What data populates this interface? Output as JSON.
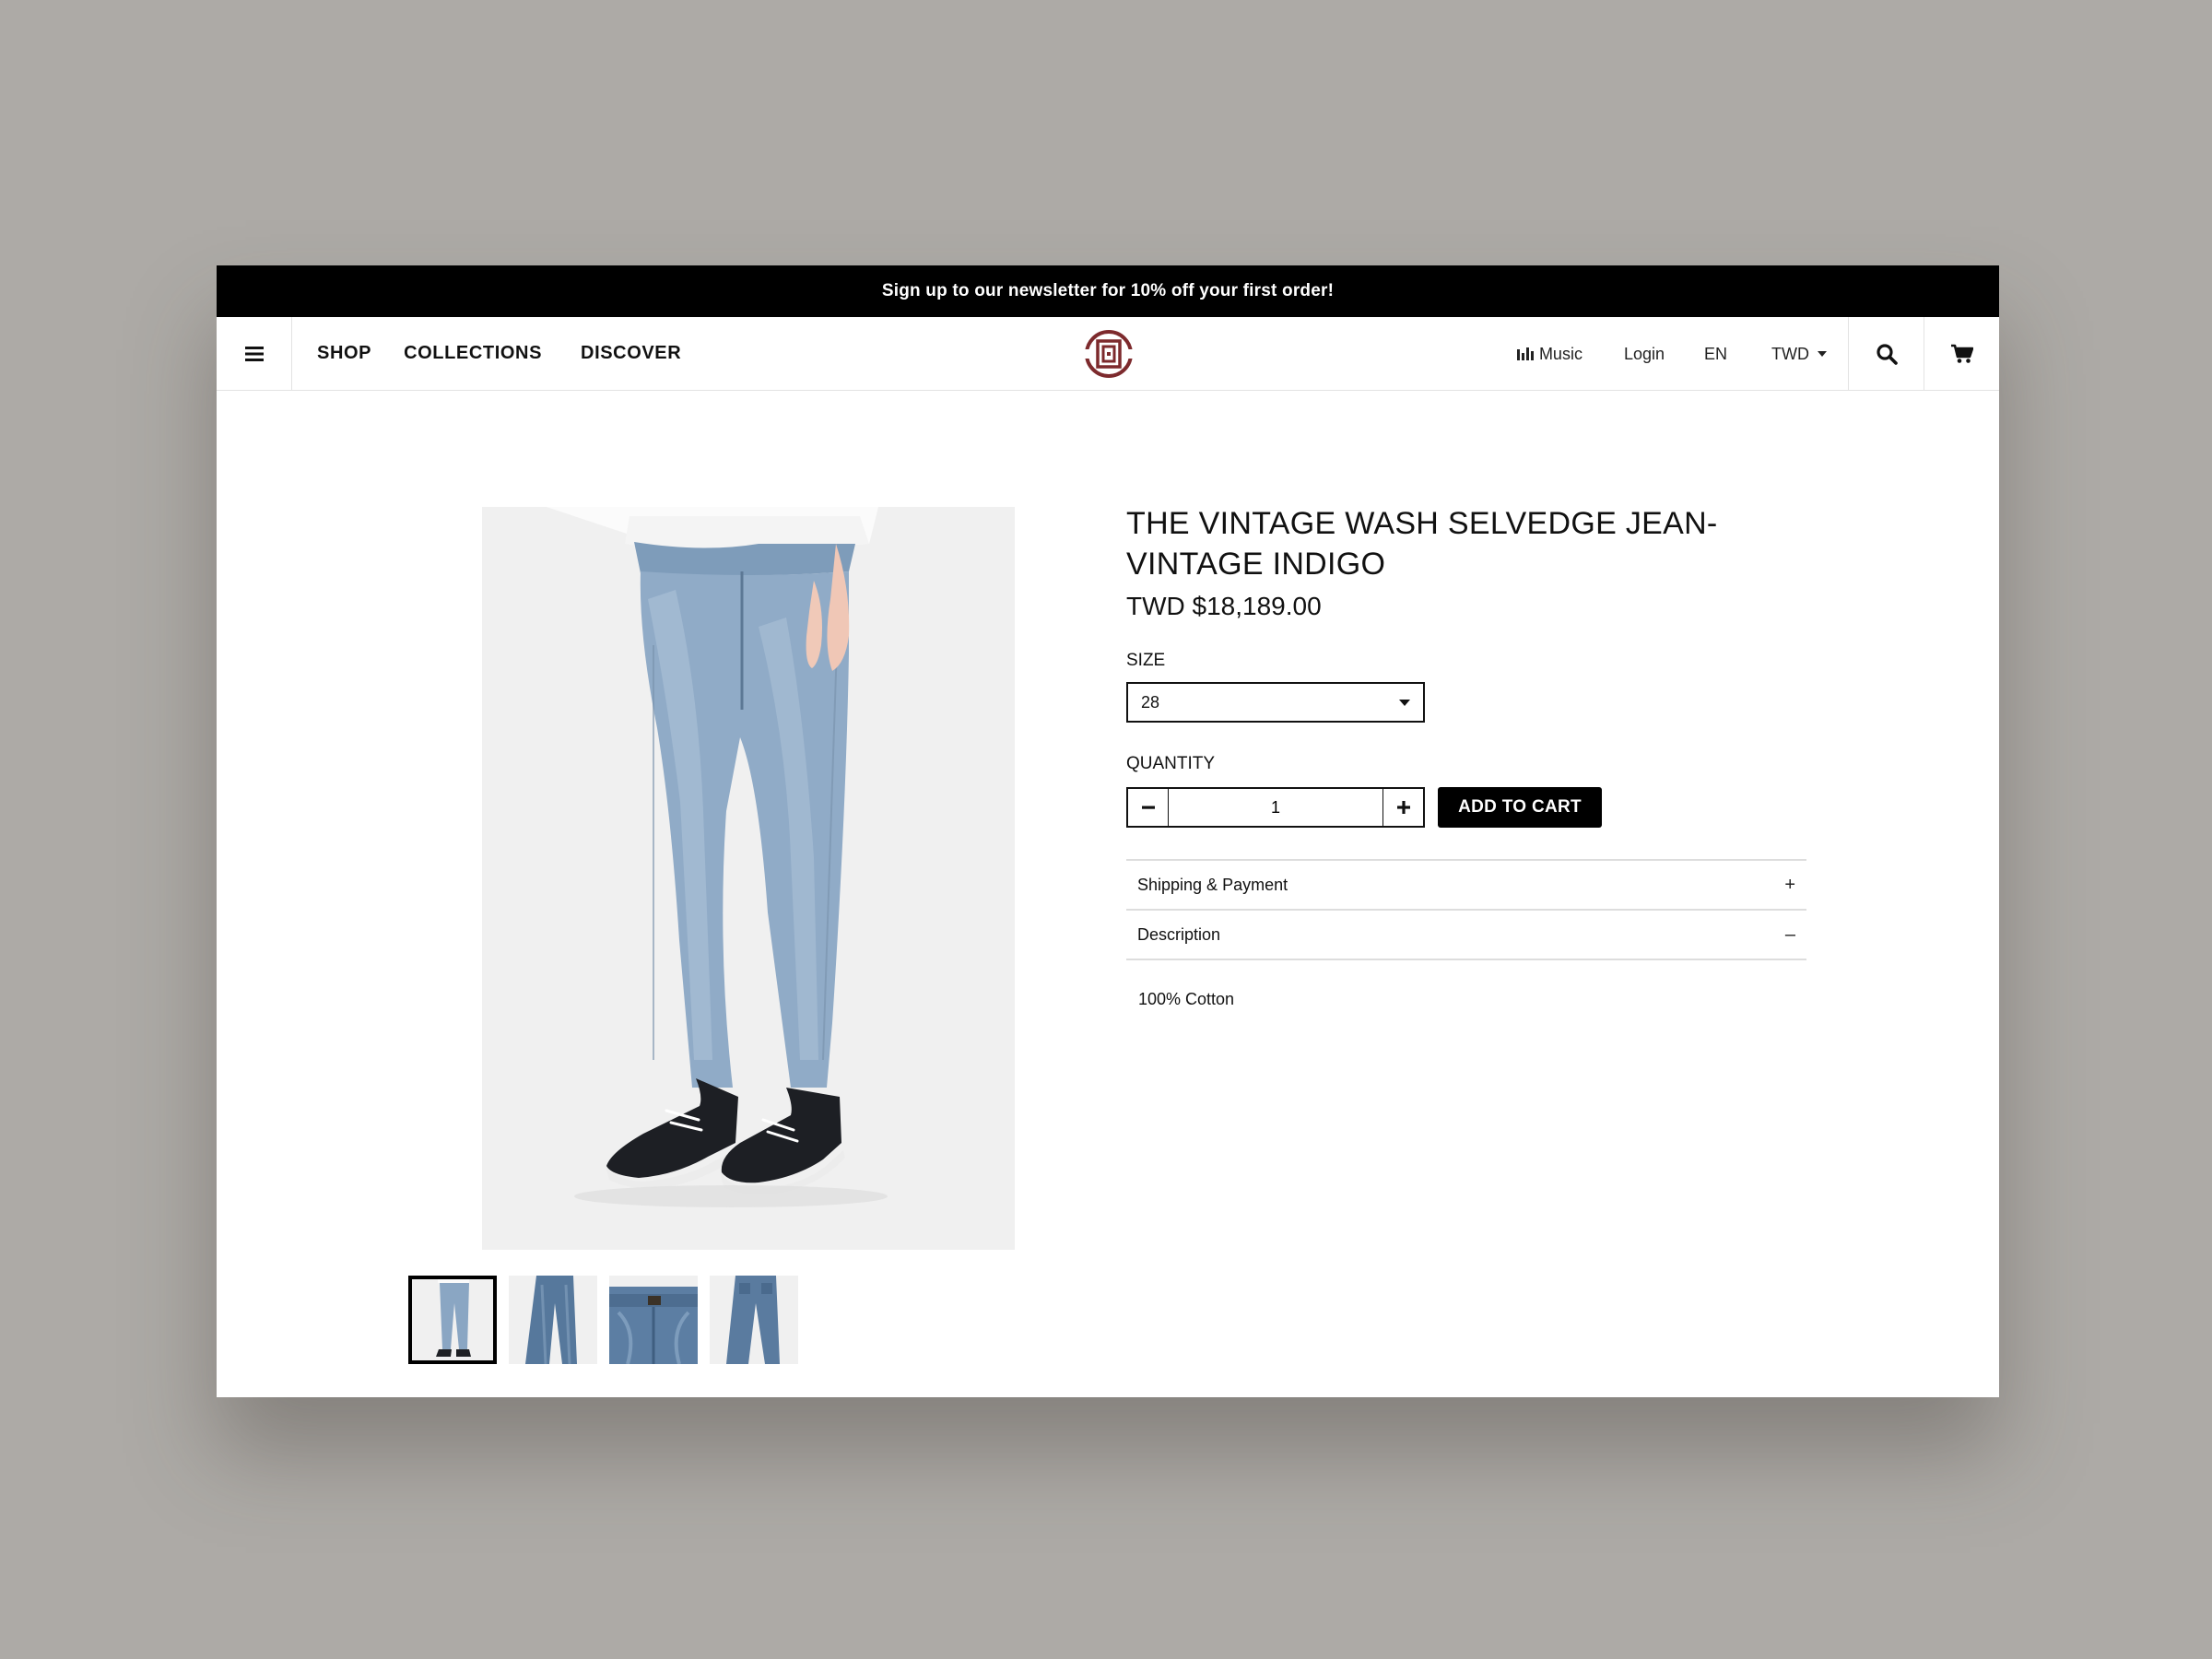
{
  "promo": {
    "text": "Sign up to our newsletter for 10% off your first order!"
  },
  "nav": {
    "menu_icon": "hamburger-menu-icon",
    "links": [
      "SHOP",
      "COLLECTIONS",
      "DISCOVER"
    ],
    "logo": "clot-logo",
    "music": "Music",
    "login": "Login",
    "language": "EN",
    "currency": "TWD",
    "search_icon": "search-icon",
    "cart_icon": "cart-icon"
  },
  "product": {
    "title": "THE VINTAGE WASH SELVEDGE JEAN- VINTAGE INDIGO",
    "price": "TWD $18,189.00",
    "size_label": "SIZE",
    "size_value": "28",
    "quantity_label": "QUANTITY",
    "quantity_value": "1",
    "add_to_cart": "ADD TO CART",
    "accordion": [
      {
        "label": "Shipping & Payment",
        "toggle": "+"
      },
      {
        "label": "Description",
        "toggle": "–"
      }
    ],
    "description": "100% Cotton",
    "thumbnail_count": 4,
    "active_thumbnail": 1
  },
  "colors": {
    "brand": "#7d2a2d",
    "promo_bg": "#000000",
    "backdrop": "#adaaa6"
  }
}
